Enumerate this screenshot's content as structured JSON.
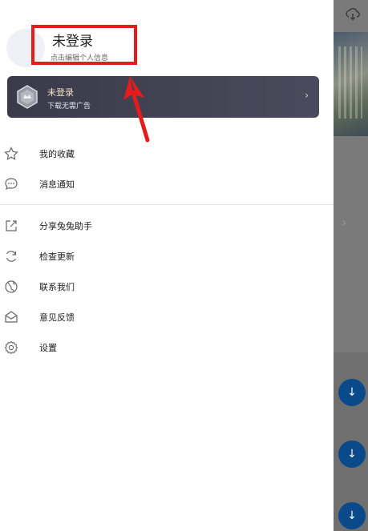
{
  "profile": {
    "name": "未登录",
    "subtitle": "点击编辑个人信息"
  },
  "vip": {
    "title": "未登录",
    "subtitle": "下载无需广告",
    "chevron": "›"
  },
  "menu": {
    "favorites": "我的收藏",
    "notifications": "消息通知",
    "share": "分享兔兔助手",
    "check_update": "检查更新",
    "contact": "联系我们",
    "feedback": "意见反馈",
    "settings": "设置"
  },
  "background": {
    "chevron": "›",
    "download_glyph": "↓"
  },
  "colors": {
    "highlight": "#e61b1b",
    "vip_card": "#3a3a4a",
    "download_button": "#0a4a8a"
  }
}
